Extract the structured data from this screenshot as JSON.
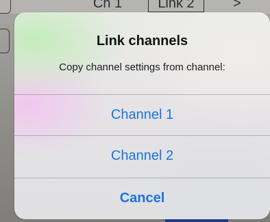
{
  "background_app": {
    "segment_channel": "Ch 1",
    "segment_link": "Link 2",
    "segment_next": ">"
  },
  "alert": {
    "title": "Link channels",
    "message": "Copy channel settings from channel:",
    "actions": [
      {
        "label": "Channel 1"
      },
      {
        "label": "Channel 2"
      },
      {
        "label": "Cancel"
      }
    ]
  },
  "colors": {
    "action_blue": "#1a73e0",
    "title_text": "#121212",
    "dim_background": "#8e8c89"
  }
}
